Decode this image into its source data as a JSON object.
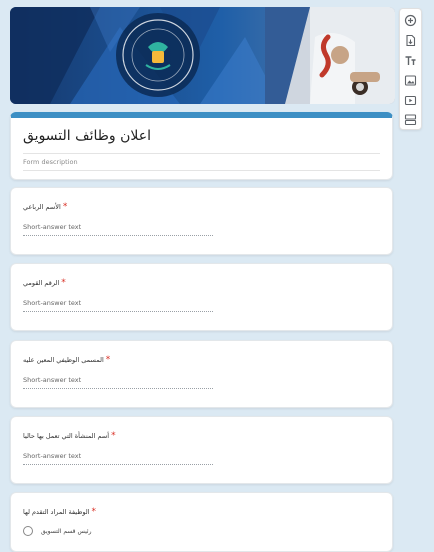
{
  "banner": {
    "alt": "EGYPT HEALTHCARE AUTHORITY"
  },
  "form": {
    "title": "اعلان وظائف التسويق",
    "description_placeholder": "Form description"
  },
  "questions": [
    {
      "label": "الأسم الرباعي",
      "answer": "Short-answer text"
    },
    {
      "label": "الرقم القومي",
      "answer": "Short-answer text"
    },
    {
      "label": "المسمى الوظيفي المعين عليه",
      "answer": "Short-answer text"
    },
    {
      "label": "أسم المنشأة التي تعمل بها حاليا",
      "answer": "Short-answer text"
    },
    {
      "label": "الوظيفة المراد التقدم لها",
      "option": "رئيس قسم التسويق"
    }
  ],
  "required_mark": "*",
  "toolbar": [
    "add-question-icon",
    "import-questions-icon",
    "add-title-icon",
    "add-image-icon",
    "add-video-icon",
    "add-section-icon"
  ],
  "colors": {
    "accent": "#3c8fc4",
    "required": "#d93025",
    "background": "#dbe9f3"
  }
}
